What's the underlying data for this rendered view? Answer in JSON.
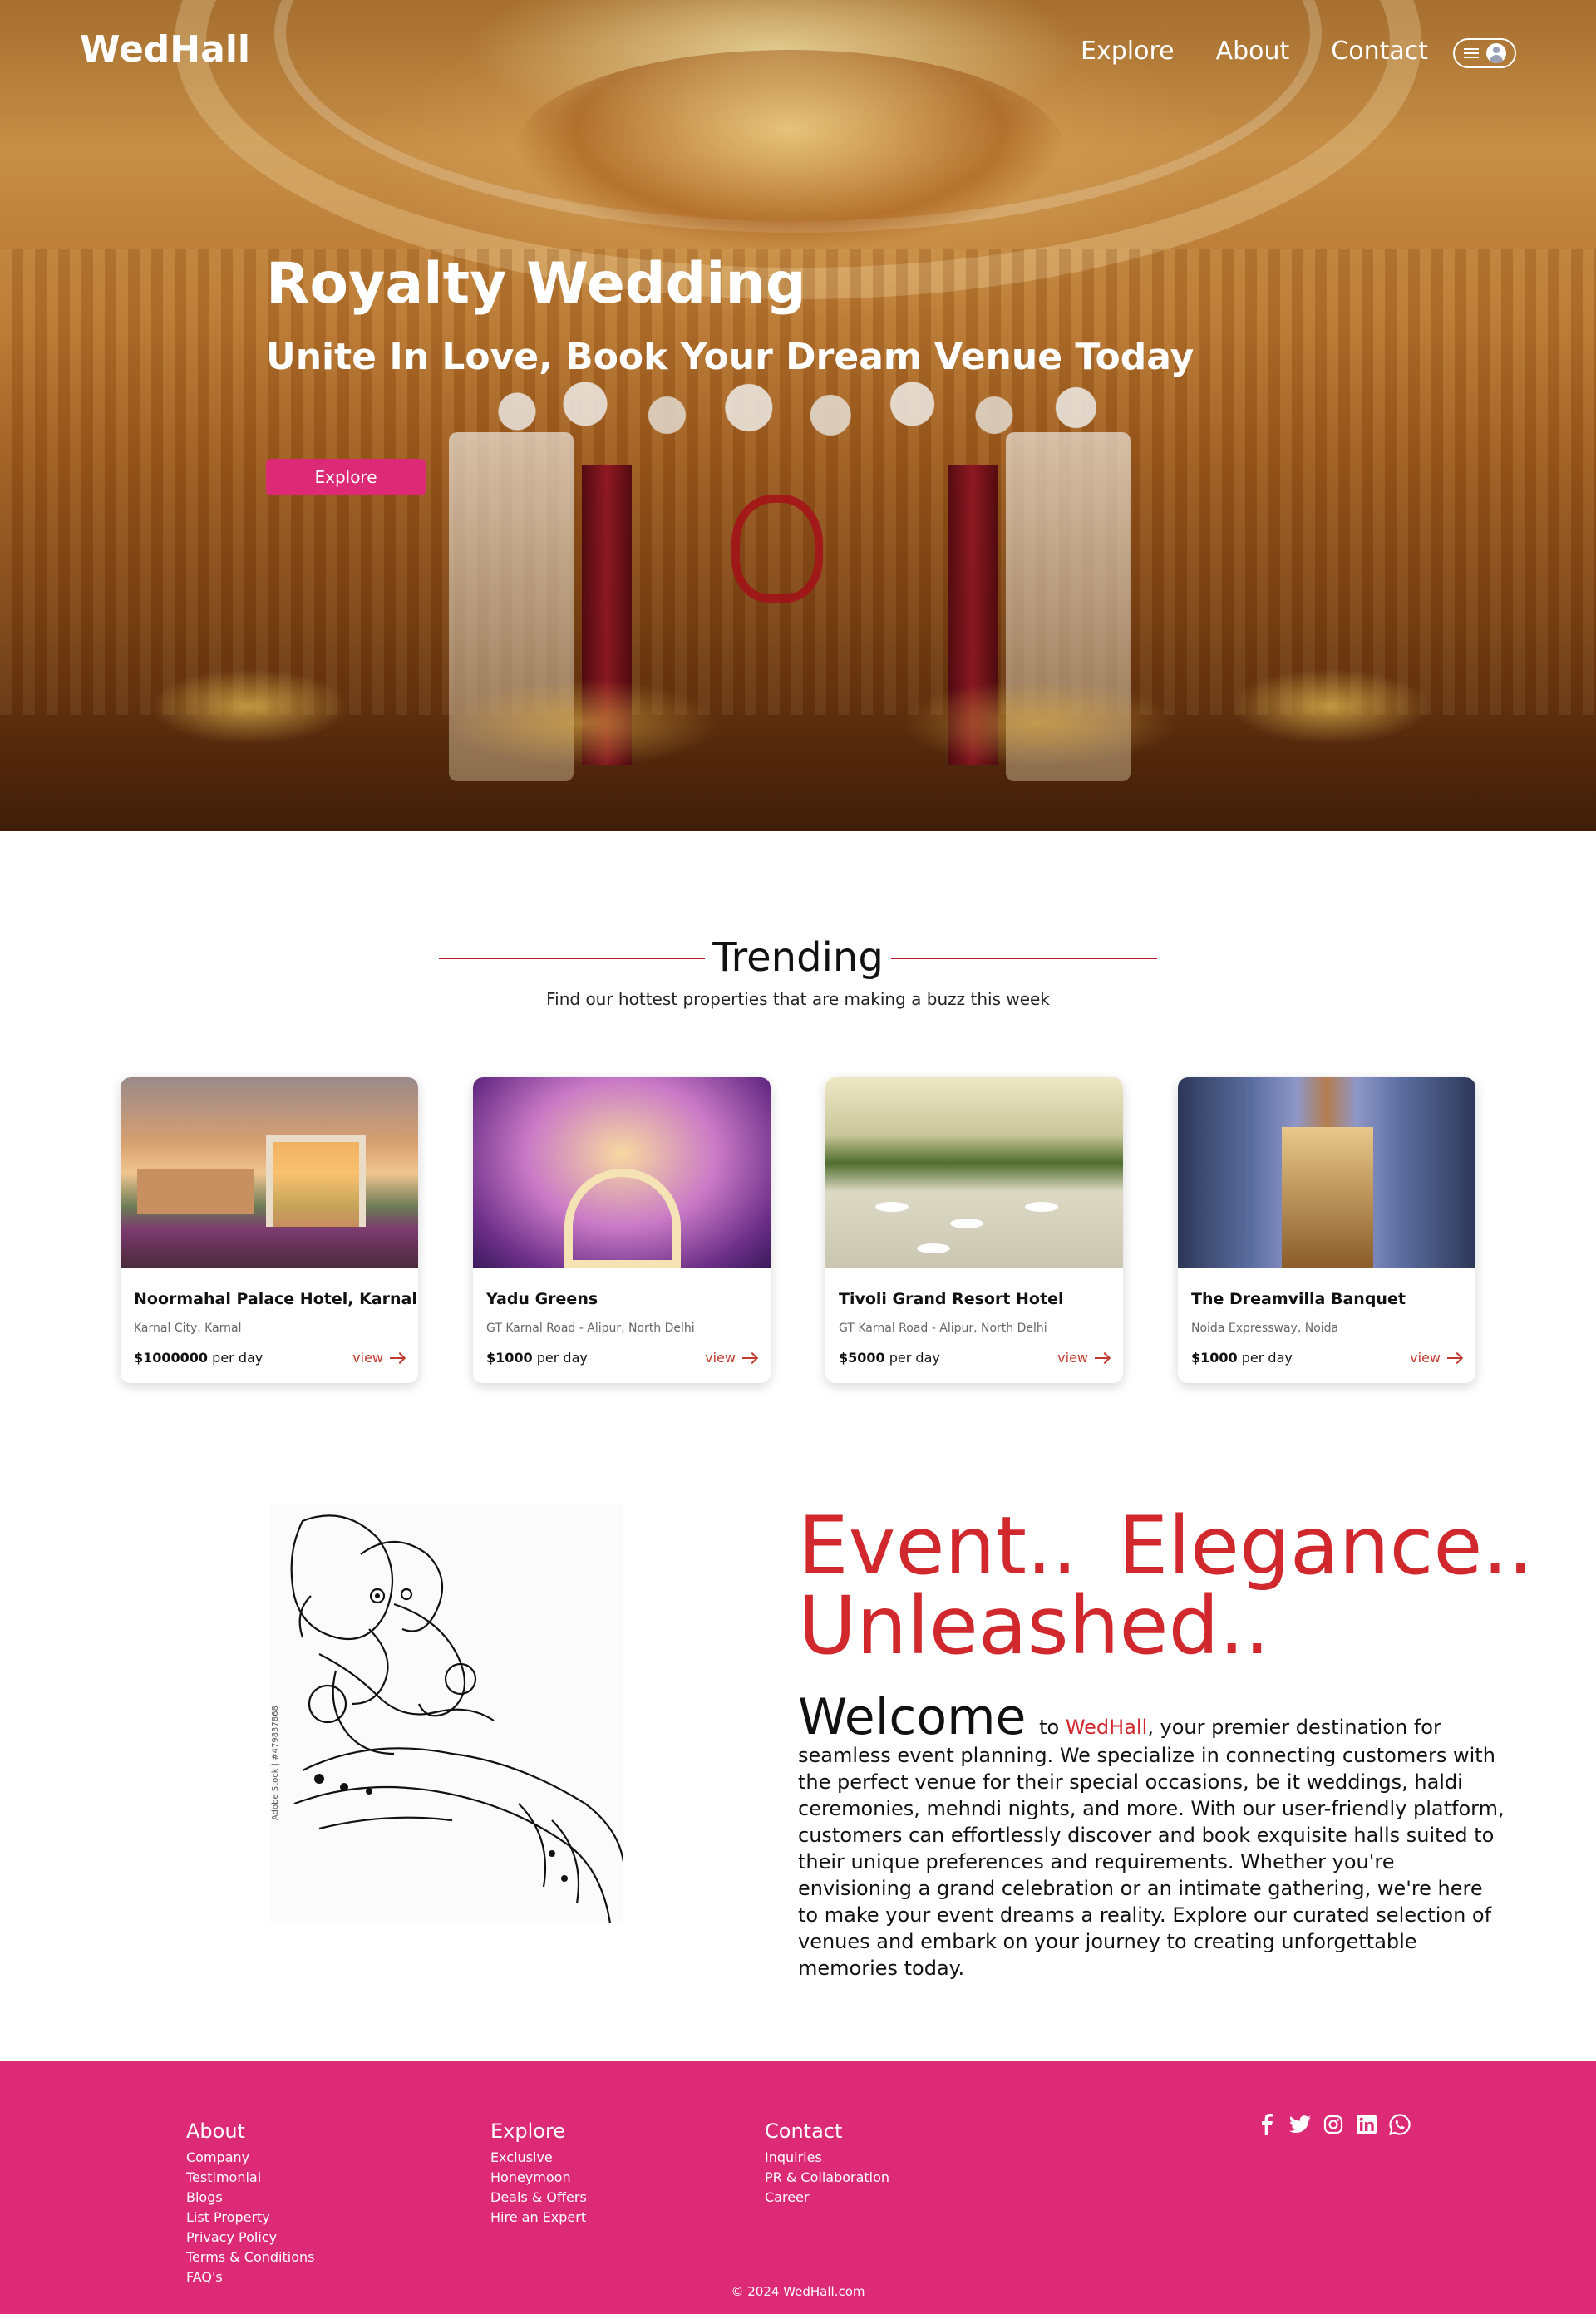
{
  "nav": {
    "logo": "WedHall",
    "links": [
      "Explore",
      "About",
      "Contact"
    ],
    "user_menu_icons": [
      "menu-icon",
      "user-avatar-icon"
    ]
  },
  "hero": {
    "title": "Royalty Wedding",
    "subtitle": "Unite In Love, Book Your Dream Venue Today",
    "button_label": "Explore"
  },
  "trending": {
    "title": "Trending",
    "subtitle": "Find our hottest properties that are making a buzz this week",
    "cards": [
      {
        "name": "Noormahal Palace Hotel, Karnal",
        "location": "Karnal City, Karnal",
        "price": "$1000000",
        "price_unit": "per day",
        "view_label": "view"
      },
      {
        "name": "Yadu Greens",
        "location": "GT Karnal Road - Alipur, North Delhi",
        "price": "$1000",
        "price_unit": "per day",
        "view_label": "view"
      },
      {
        "name": "Tivoli Grand Resort Hotel",
        "location": "GT Karnal Road - Alipur, North Delhi",
        "price": "$5000",
        "price_unit": "per day",
        "view_label": "view"
      },
      {
        "name": "The Dreamvilla Banquet",
        "location": "Noida Expressway, Noida",
        "price": "$1000",
        "price_unit": "per day",
        "view_label": "view"
      }
    ]
  },
  "about": {
    "sketch_caption": "Adobe Stock | #479837868",
    "tagline": "Event..  Elegance.. Unleashed..",
    "welcome_big": "Welcome",
    "welcome_to": "to",
    "brand": "WedHall",
    "body": ", your premier destination for seamless event planning. We specialize in connecting customers with the perfect venue for their special occasions, be it weddings, haldi ceremonies, mehndi nights, and more. With our user-friendly platform, customers can effortlessly discover and book exquisite halls suited to their unique preferences and requirements. Whether you're envisioning a grand celebration or an intimate gathering, we're here to make your event dreams a reality. Explore our curated selection of venues and embark on your journey to creating unforgettable memories today."
  },
  "footer": {
    "about": {
      "heading": "About",
      "links": [
        "Company",
        "Testimonial",
        "Blogs",
        "List Property",
        "Privacy Policy",
        "Terms & Conditions",
        "FAQ's"
      ]
    },
    "explore": {
      "heading": "Explore",
      "links": [
        "Exclusive",
        "Honeymoon",
        "Deals & Offers",
        "Hire an Expert"
      ]
    },
    "contact": {
      "heading": "Contact",
      "links": [
        "Inquiries",
        "PR & Collaboration",
        "Career"
      ]
    },
    "socials": [
      "facebook-icon",
      "twitter-icon",
      "instagram-icon",
      "linkedin-icon",
      "whatsapp-icon"
    ],
    "copyright": "© 2024 WedHall.com"
  },
  "colors": {
    "accent": "#dc2a77",
    "brand_red": "#d0282c",
    "footer_bg": "#dc2a77"
  }
}
